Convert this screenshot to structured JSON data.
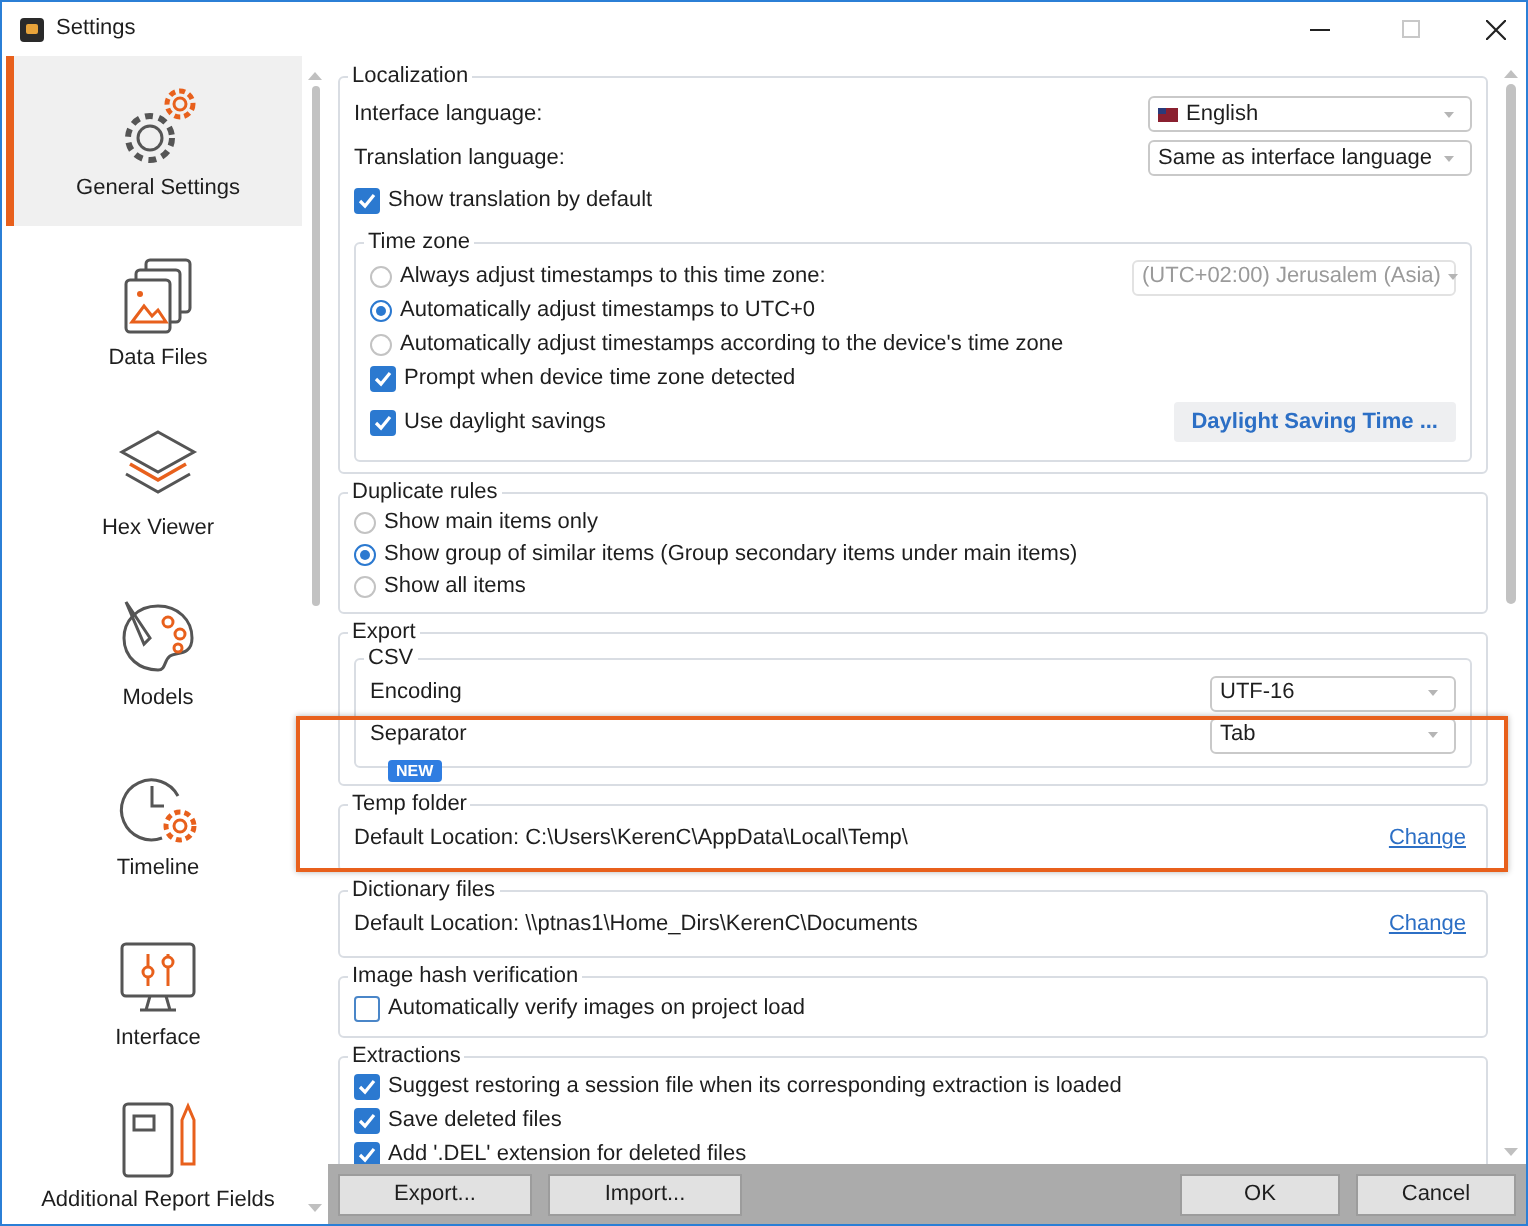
{
  "window": {
    "title": "Settings"
  },
  "sidebar": {
    "items": [
      {
        "label": "General Settings",
        "selected": true
      },
      {
        "label": "Data Files",
        "selected": false
      },
      {
        "label": "Hex Viewer",
        "selected": false
      },
      {
        "label": "Models",
        "selected": false
      },
      {
        "label": "Timeline",
        "selected": false
      },
      {
        "label": "Interface",
        "selected": false
      },
      {
        "label": "Additional Report Fields",
        "selected": false
      }
    ]
  },
  "localization": {
    "title": "Localization",
    "interface_language": {
      "label": "Interface language:",
      "value": "English"
    },
    "translation_language": {
      "label": "Translation language:",
      "value": "Same as interface language"
    },
    "show_translation": {
      "label": "Show translation by default",
      "checked": true
    },
    "time_zone": {
      "title": "Time zone",
      "options": [
        {
          "label": "Always adjust timestamps to this time zone:",
          "selected": false
        },
        {
          "label": "Automatically adjust timestamps to UTC+0",
          "selected": true
        },
        {
          "label": "Automatically adjust timestamps according to the device's time zone",
          "selected": false
        }
      ],
      "zone": {
        "value": "(UTC+02:00)  Jerusalem  (Asia)",
        "disabled": true
      },
      "prompt": {
        "label": "Prompt when device time zone detected",
        "checked": true
      },
      "daylight": {
        "label": "Use daylight savings",
        "checked": true
      },
      "dst_button": "Daylight Saving Time ..."
    }
  },
  "duplicate_rules": {
    "title": "Duplicate rules",
    "options": [
      {
        "label": "Show main items only",
        "selected": false
      },
      {
        "label": "Show group of similar items (Group secondary items under main items)",
        "selected": true
      },
      {
        "label": "Show all items",
        "selected": false
      }
    ]
  },
  "export": {
    "title": "Export",
    "csv": {
      "title": "CSV",
      "encoding": {
        "label": "Encoding",
        "value": "UTF-16"
      },
      "separator": {
        "label": "Separator",
        "value": "Tab"
      }
    }
  },
  "temp_folder": {
    "title": "Temp folder",
    "badge": "NEW",
    "location": "Default Location:  C:\\Users\\KerenC\\AppData\\Local\\Temp\\",
    "link": "Change"
  },
  "dictionary_files": {
    "title": "Dictionary files",
    "location": "Default Location:  \\\\ptnas1\\Home_Dirs\\KerenC\\Documents",
    "link": "Change"
  },
  "image_hash": {
    "title": "Image hash verification",
    "options": [
      {
        "label": "Automatically verify images on project load",
        "checked": false
      }
    ]
  },
  "extractions": {
    "title": "Extractions",
    "options": [
      {
        "label": "Suggest restoring a session file when its corresponding extraction is loaded",
        "checked": true
      },
      {
        "label": "Save deleted files",
        "checked": true
      },
      {
        "label": "Add '.DEL' extension for deleted files",
        "checked": true
      }
    ]
  },
  "footer": {
    "left_buttons": [
      "Export...",
      "Import..."
    ],
    "right_buttons": [
      "OK",
      "Cancel"
    ]
  }
}
